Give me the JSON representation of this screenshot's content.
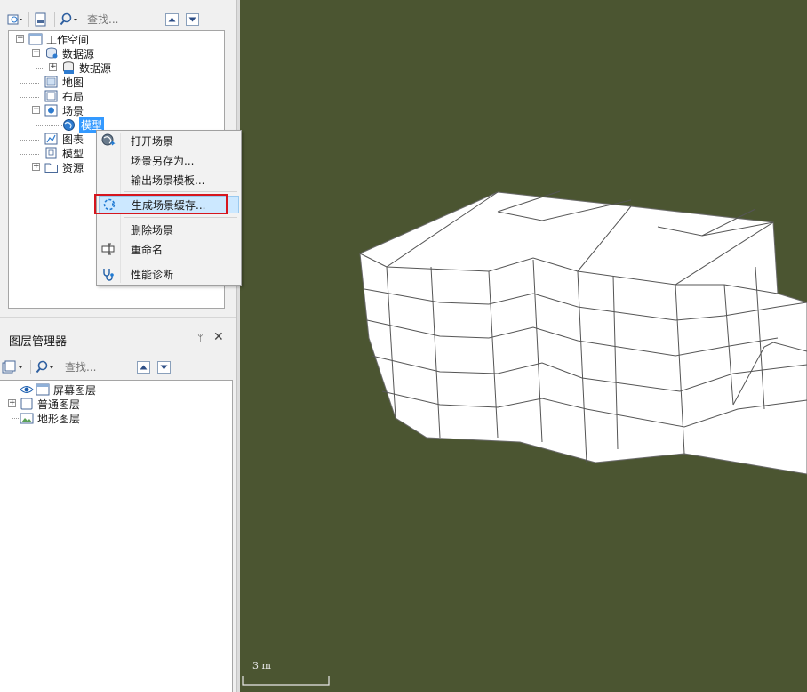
{
  "workspace_tree": {
    "search_placeholder": "查找...",
    "nodes": {
      "workspace": "工作空间",
      "datasources": "数据源",
      "datasource_child": "数据源",
      "maps": "地图",
      "layouts": "布局",
      "scenes": "场景",
      "scene_model": "模型",
      "charts": "图表",
      "models": "模型",
      "resources": "资源"
    }
  },
  "context_menu": {
    "items": [
      {
        "label": "打开场景",
        "icon": "globe-open-icon"
      },
      {
        "label": "场景另存为...",
        "icon": ""
      },
      {
        "label": "输出场景模板...",
        "icon": ""
      },
      {
        "label": "生成场景缓存...",
        "icon": "cache-generate-icon",
        "highlighted": true
      },
      {
        "label": "删除场景",
        "icon": ""
      },
      {
        "label": "重命名",
        "icon": "rename-icon"
      },
      {
        "label": "性能诊断",
        "icon": "stethoscope-icon"
      }
    ]
  },
  "layer_manager": {
    "title": "图层管理器",
    "pin_glyph": "ᛘ",
    "close_glyph": "✕",
    "search_placeholder": "查找...",
    "layers": {
      "screen": "屏幕图层",
      "normal": "普通图层",
      "terrain": "地形图层"
    }
  },
  "scene_view": {
    "background_color": "#4b5531",
    "scale_label": "3 m"
  },
  "colors": {
    "highlight_border": "#d6161e",
    "selection": "#3399ff"
  }
}
